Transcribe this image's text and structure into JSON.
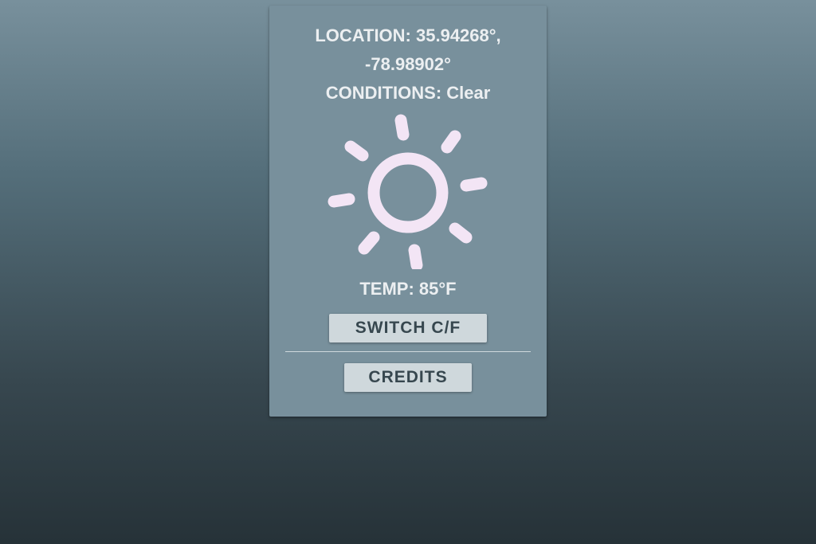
{
  "weather": {
    "location_line1": "LOCATION: 35.94268°,",
    "location_line2": "-78.98902°",
    "conditions": "CONDITIONS: Clear",
    "icon": "sun-icon",
    "temperature": "TEMP: 85°F"
  },
  "buttons": {
    "switch_units_label": "SWITCH C/F",
    "credits_label": "CREDITS"
  },
  "colors": {
    "card_background": "#78909c",
    "text": "#eceff1",
    "sun": "#f3e5f5",
    "button_background": "#cfd8dc",
    "button_text": "#37474f"
  }
}
